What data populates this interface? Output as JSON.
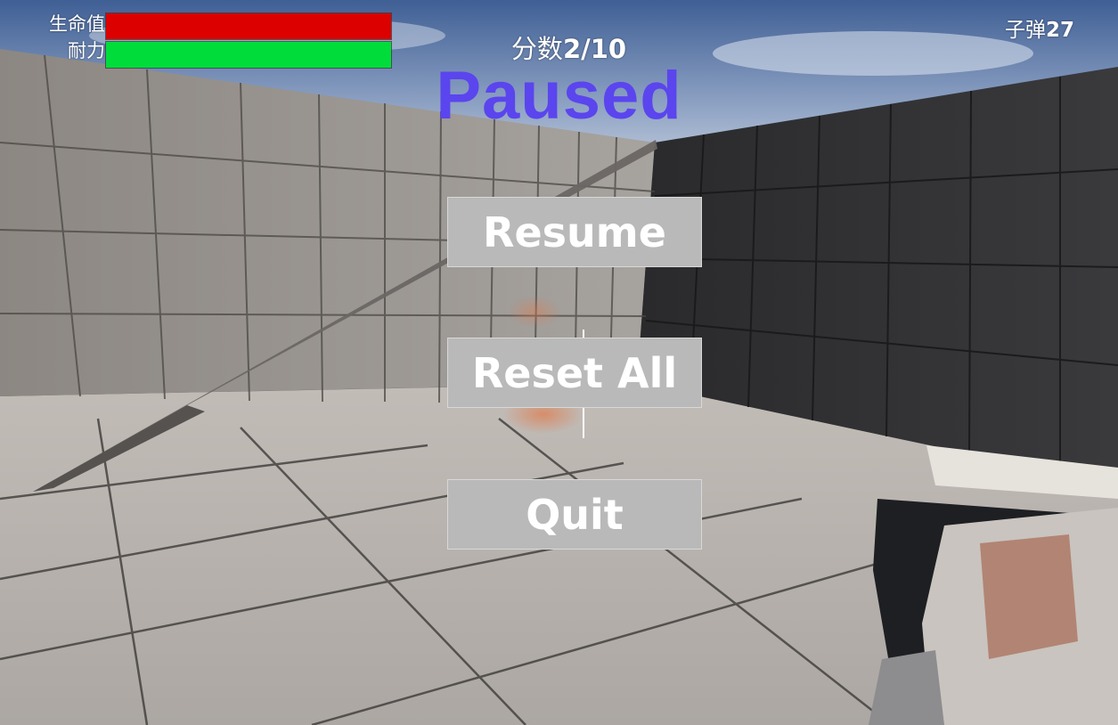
{
  "hud": {
    "health_label": "生命值",
    "health_fraction": 1.0,
    "stamina_label": "耐力",
    "stamina_fraction": 1.0,
    "score_label": "分数",
    "score_value": "2/10",
    "ammo_label": "子弹",
    "ammo_value": "27"
  },
  "pause_menu": {
    "title": "Paused",
    "buttons": {
      "resume": "Resume",
      "reset_all": "Reset All",
      "quit": "Quit"
    }
  },
  "colors": {
    "health": "#dd0000",
    "stamina": "#00dd3a",
    "title": "#5b45ee",
    "button": "#b9b9b9"
  },
  "icons": {
    "crosshair": "crosshair-icon",
    "weapon": "rifle-first-person"
  }
}
